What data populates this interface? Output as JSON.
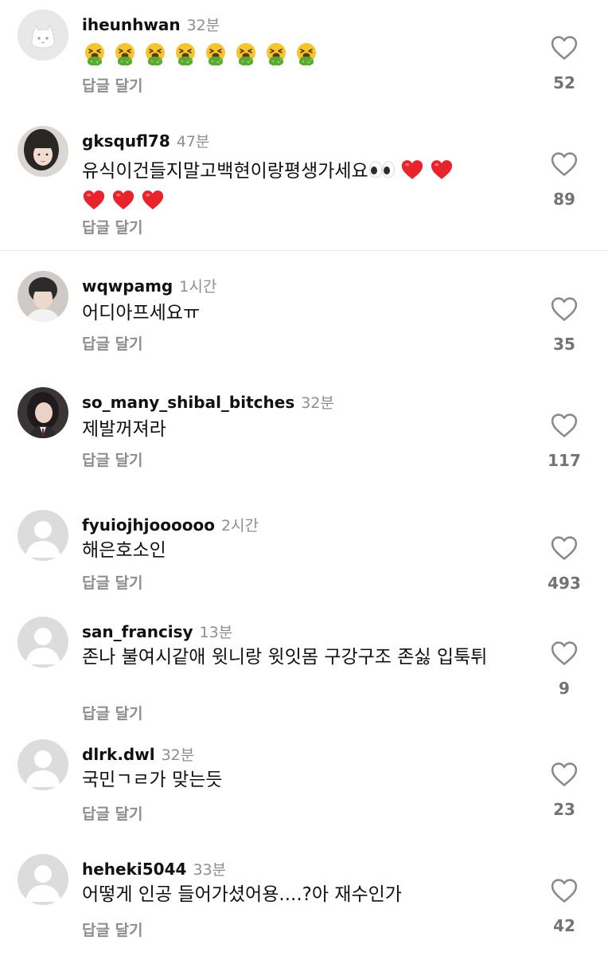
{
  "reply_label": "답글 달기",
  "colors": {
    "username": "#111111",
    "meta_gray": "#8e8e8e",
    "count_gray": "#737373",
    "heart_red": "#e8232c",
    "default_avatar_bg": "#dcdcdc"
  },
  "comments": [
    {
      "username": "iheunhwan",
      "time": "32분",
      "text": "🤮🤮🤮🤮🤮🤮🤮🤮",
      "likes": "52",
      "avatar": "cat-avatar"
    },
    {
      "username": "gksqufl78",
      "time": "47분",
      "text": "유식이건들지말고백현이랑평생가세요👀❤️❤️❤️❤️❤️",
      "text_plain": "유식이건들지말고백현이랑평생가세요",
      "likes": "89",
      "avatar": "photo-avatar"
    },
    {
      "username": "wqwpamg",
      "time": "1시간",
      "text": "어디아프세요ㅠ",
      "likes": "35",
      "avatar": "photo-avatar"
    },
    {
      "username": "so_many_shibal_bitches",
      "time": "32분",
      "text": "제발꺼져라",
      "likes": "117",
      "avatar": "photo-avatar"
    },
    {
      "username": "fyuiojhjoooooo",
      "time": "2시간",
      "text": "해은호소인",
      "likes": "493",
      "avatar": "default-avatar"
    },
    {
      "username": "san_francisy",
      "time": "13분",
      "text": "존나 불여시같애 윗니랑 윗잇몸 구강구조 존싫 입툭튀",
      "likes": "9",
      "avatar": "default-avatar"
    },
    {
      "username": "dlrk.dwl",
      "time": "32분",
      "text": "국민ㄱㄹ가 맞는듯",
      "likes": "23",
      "avatar": "default-avatar"
    },
    {
      "username": "heheki5044",
      "time": "33분",
      "text": "어떻게 인공 들어가셨어용....?아 재수인가",
      "likes": "42",
      "avatar": "default-avatar"
    }
  ]
}
